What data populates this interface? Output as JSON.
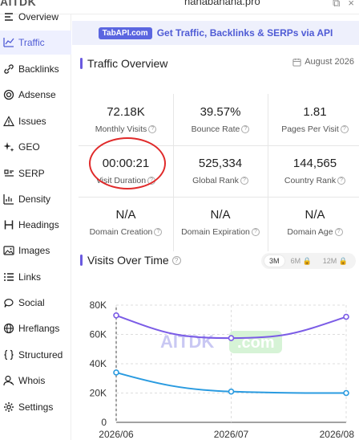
{
  "app": {
    "brand": "AITDK",
    "domain": "nanabanana.pro"
  },
  "sidebar": {
    "items": [
      {
        "label": "Overview",
        "icon": "overview-icon",
        "active": false
      },
      {
        "label": "Traffic",
        "icon": "traffic-icon",
        "active": true
      },
      {
        "label": "Backlinks",
        "icon": "link-icon",
        "active": false
      },
      {
        "label": "Adsense",
        "icon": "adsense-icon",
        "active": false
      },
      {
        "label": "Issues",
        "icon": "warning-icon",
        "active": false
      },
      {
        "label": "GEO",
        "icon": "sparkle-icon",
        "active": false
      },
      {
        "label": "SERP",
        "icon": "serp-icon",
        "active": false
      },
      {
        "label": "Density",
        "icon": "density-icon",
        "active": false
      },
      {
        "label": "Headings",
        "icon": "heading-icon",
        "active": false
      },
      {
        "label": "Images",
        "icon": "image-icon",
        "active": false
      },
      {
        "label": "Links",
        "icon": "list-icon",
        "active": false
      },
      {
        "label": "Social",
        "icon": "social-icon",
        "active": false
      },
      {
        "label": "Hreflangs",
        "icon": "globe-icon",
        "active": false
      },
      {
        "label": "Structured",
        "icon": "braces-icon",
        "active": false
      },
      {
        "label": "Whois",
        "icon": "user-icon",
        "active": false
      },
      {
        "label": "Settings",
        "icon": "gear-icon",
        "active": false
      }
    ]
  },
  "banner": {
    "tag": "TabAPI.com",
    "text": "Get Traffic, Backlinks & SERPs via API"
  },
  "overview": {
    "title": "Traffic Overview",
    "date": "August 2026",
    "stats": [
      {
        "value": "72.18K",
        "label": "Monthly Visits"
      },
      {
        "value": "39.57%",
        "label": "Bounce Rate"
      },
      {
        "value": "1.81",
        "label": "Pages Per Visit"
      },
      {
        "value": "00:00:21",
        "label": "Visit Duration"
      },
      {
        "value": "525,334",
        "label": "Global Rank"
      },
      {
        "value": "144,565",
        "label": "Country Rank"
      },
      {
        "value": "N/A",
        "label": "Domain Creation"
      },
      {
        "value": "N/A",
        "label": "Domain Expiration"
      },
      {
        "value": "N/A",
        "label": "Domain Age"
      }
    ]
  },
  "visits": {
    "title": "Visits Over Time",
    "ranges": [
      "3M",
      "6M",
      "12M"
    ],
    "selected_range": "3M",
    "watermark": "AITDK",
    "watermark_suffix": ".com"
  },
  "chart_data": {
    "type": "line",
    "x": [
      "2026/06",
      "2026/07",
      "2026/08"
    ],
    "ylim": [
      0,
      80000
    ],
    "yticks": [
      "0",
      "20K",
      "40K",
      "60K",
      "80K"
    ],
    "series": [
      {
        "values": [
          73000,
          57500,
          72000
        ],
        "color": "#7b5ce6"
      },
      {
        "values": [
          34000,
          21000,
          20000
        ],
        "color": "#2a9be0"
      }
    ],
    "grid": true
  }
}
